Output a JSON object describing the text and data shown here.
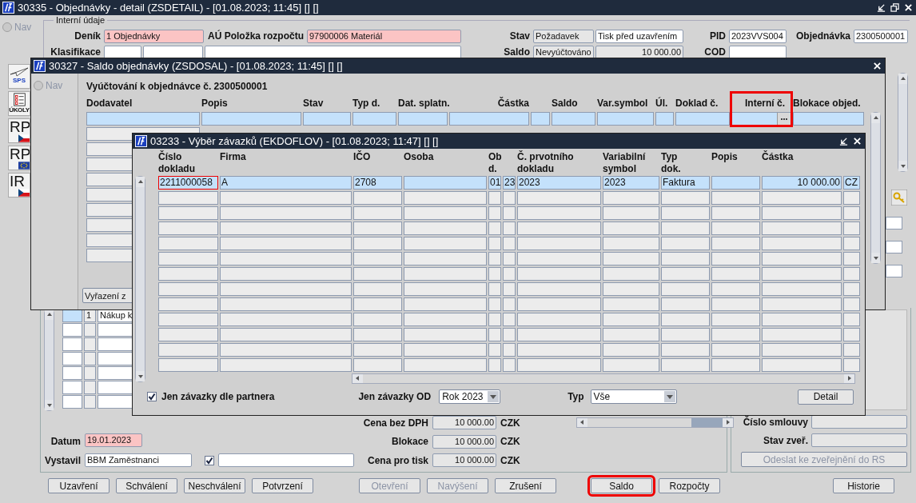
{
  "main_window": {
    "title": "30335 - Objednávky - detail (ZSDETAIL) - [01.08.2023; 11:45] [] []",
    "nav": {
      "label": "Nav",
      "selected": false,
      "disabled": true
    },
    "toolbar": [
      {
        "kind": "plane",
        "label": "SPS"
      },
      {
        "kind": "tasks",
        "label": "ÚKOLY"
      },
      {
        "kind": "cz",
        "label": "RP"
      },
      {
        "kind": "eu",
        "label": "RP"
      },
      {
        "kind": "cz",
        "label": "IR"
      }
    ],
    "section_title": "Interní údaje",
    "header_rows": [
      [
        {
          "label": "Deník",
          "fields": [
            {
              "value": "1 Objednávky",
              "kind": "required"
            }
          ]
        },
        {
          "label": "AÚ Položka rozpočtu",
          "fields": [
            {
              "value": "97900006 Materiál",
              "kind": "required"
            }
          ]
        },
        {
          "label": "Stav",
          "fields": [
            {
              "value": "Požadavek",
              "kind": "readonly"
            },
            {
              "value": "Tisk před uzavřením",
              "kind": "editable"
            }
          ]
        },
        {
          "label": "PID",
          "fields": [
            {
              "value": "2023VVS004",
              "kind": "editable"
            }
          ]
        },
        {
          "label": "Objednávka",
          "fields": [
            {
              "value": "2300500001",
              "kind": "editable"
            }
          ]
        }
      ],
      [
        {
          "label": "Klasifikace",
          "fields": [
            {
              "kind": "editable"
            },
            {
              "kind": "editable"
            },
            {
              "kind": "editable"
            }
          ]
        },
        {
          "label": "Saldo",
          "fields": [
            {
              "value": "Nevyúčtováno",
              "kind": "readonly"
            },
            {
              "value": "10 000.00",
              "kind": "readonly",
              "numeric": true
            }
          ]
        },
        {
          "label": "COD",
          "fields": [
            {
              "kind": "editable"
            }
          ]
        }
      ]
    ],
    "lower_table": {
      "rows": [
        {
          "selected": true,
          "cells": [
            {},
            {
              "value": "1"
            },
            {
              "value": "Nákup k"
            }
          ]
        },
        {
          "selected": false
        },
        {
          "selected": false
        },
        {
          "selected": false
        },
        {
          "selected": false
        },
        {
          "selected": false
        },
        {
          "selected": false
        }
      ]
    },
    "totals": [
      {
        "label": "Cena bez DPH",
        "value": "10 000.00",
        "currency": "CZK"
      },
      {
        "label": "Blokace",
        "value": "10 000.00",
        "currency": "CZK"
      },
      {
        "label": "Cena pro tisk",
        "value": "10 000.00",
        "currency": "CZK"
      }
    ],
    "date": {
      "label": "Datum",
      "value": "19.01.2023",
      "kind": "required"
    },
    "issuer": {
      "label": "Vystavil",
      "value": "BBM Zaměstnanci",
      "checked": true
    },
    "contract": {
      "number_label": "Číslo smlouvy",
      "status_label": "Stav zveř.",
      "publish_button": {
        "label": "Odeslat ke zveřejnění do RS",
        "disabled": true
      }
    },
    "button_groups": [
      [
        {
          "label": "Uzavření",
          "disabled": false,
          "highlighted": false
        },
        {
          "label": "Schválení",
          "disabled": false,
          "highlighted": false
        },
        {
          "label": "Neschválení",
          "disabled": false,
          "highlighted": false
        },
        {
          "label": "Potvrzení",
          "disabled": false,
          "highlighted": false
        }
      ],
      [
        {
          "label": "Otevření",
          "disabled": true,
          "highlighted": false
        },
        {
          "label": "Navýšení",
          "disabled": true,
          "highlighted": false
        },
        {
          "label": "Zrušení",
          "disabled": false,
          "highlighted": false
        }
      ],
      [
        {
          "label": "Saldo",
          "disabled": false,
          "highlighted": true
        },
        {
          "label": "Rozpočty",
          "disabled": false,
          "highlighted": false
        }
      ],
      [
        {
          "label": "Historie",
          "disabled": false,
          "highlighted": false
        }
      ]
    ]
  },
  "saldo_window": {
    "title": "30327 - Saldo objednávky (ZSDOSAL) - [01.08.2023; 11:45] [] []",
    "nav": {
      "label": "Nav",
      "selected": false,
      "disabled": true
    },
    "heading": "Vyúčtování k objednávce č. 2300500001",
    "columns": [
      {
        "header": "Dodavatel",
        "highlighted": false
      },
      {
        "header": "Popis",
        "highlighted": false
      },
      {
        "header": "Stav",
        "highlighted": false
      },
      {
        "header": "Typ d.",
        "highlighted": false
      },
      {
        "header": "Dat. splatn.",
        "highlighted": false
      },
      {
        "header": "Částka",
        "highlighted": false,
        "numeric": true
      },
      {
        "highlighted": false
      },
      {
        "header": "Saldo",
        "highlighted": false
      },
      {
        "header": "Var.symbol",
        "highlighted": false
      },
      {
        "header": "Úl.",
        "highlighted": false
      },
      {
        "header": "Doklad č.",
        "highlighted": false
      },
      {
        "header": "Interní č.",
        "highlighted": true,
        "numeric": true,
        "lookup": true
      },
      {
        "header": "Blokace objed.",
        "highlighted": false
      }
    ],
    "rows": [
      {
        "selected": true
      },
      {
        "selected": false
      },
      {
        "selected": false
      },
      {
        "selected": false
      },
      {
        "selected": false
      },
      {
        "selected": false
      },
      {
        "selected": false
      },
      {
        "selected": false
      },
      {
        "selected": false
      },
      {
        "selected": false
      }
    ],
    "button": "Vyřazení z"
  },
  "dialog": {
    "title": "03233 - Výběr závazků (EKDOFLOV) - [01.08.2023; 11:47] [] []",
    "columns": [
      {
        "header": "Číslo\ndokladu"
      },
      {
        "header": "Firma"
      },
      {
        "header": "IČO"
      },
      {
        "header": "Osoba"
      },
      {
        "header": "Ob\nd."
      },
      {},
      {
        "header": "Č. prvotního\ndokladu"
      },
      {
        "header": "Variabilní\nsymbol"
      },
      {
        "header": "Typ\ndok."
      },
      {
        "header": "Popis"
      },
      {
        "header": "Částka",
        "numeric": true
      },
      {}
    ],
    "rows": [
      {
        "selected": true,
        "cells": [
          {
            "value": "2211000058",
            "current": true
          },
          {
            "value": "A"
          },
          {
            "value": "2708"
          },
          {},
          {
            "value": "01"
          },
          {
            "value": "23"
          },
          {
            "value": "2023"
          },
          {
            "value": "2023"
          },
          {
            "value": "Faktura"
          },
          {},
          {
            "value": "10 000.00"
          },
          {
            "value": "CZ"
          }
        ]
      },
      {
        "selected": false
      },
      {
        "selected": false
      },
      {
        "selected": false
      },
      {
        "selected": false
      },
      {
        "selected": false
      },
      {
        "selected": false
      },
      {
        "selected": false
      },
      {
        "selected": false
      },
      {
        "selected": false
      },
      {
        "selected": false
      },
      {
        "selected": false
      },
      {
        "selected": false
      }
    ],
    "partner_only": {
      "label": "Jen závazky dle partnera",
      "checked": true
    },
    "selects": [
      {
        "label": "Jen závazky OD",
        "value": "Rok 2023"
      },
      {
        "label": "Typ",
        "value": "Vše"
      }
    ],
    "detail_button": "Detail"
  }
}
